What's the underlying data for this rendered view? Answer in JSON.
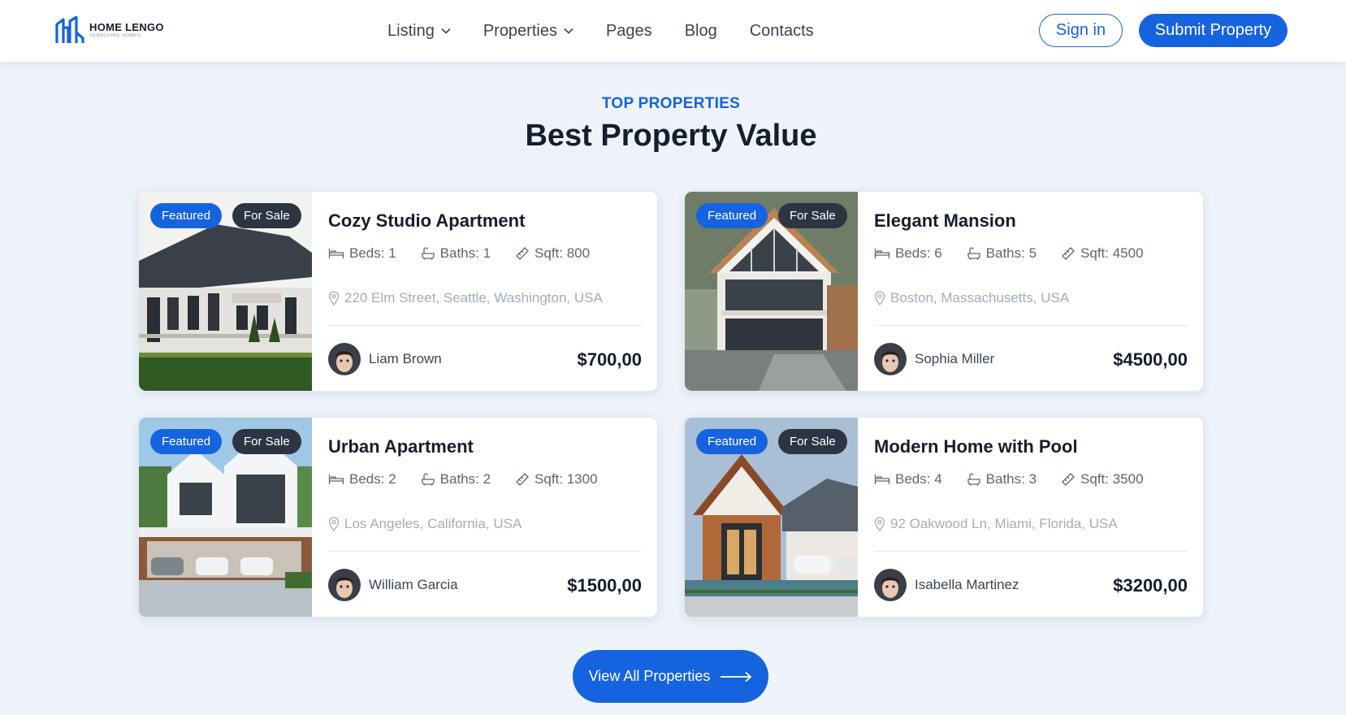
{
  "brand": {
    "name": "HOME LENGO",
    "tagline": "SEARCHING HOMES",
    "color": "#1563df"
  },
  "nav": {
    "items": [
      {
        "label": "Listing",
        "dropdown": true
      },
      {
        "label": "Properties",
        "dropdown": true
      },
      {
        "label": "Pages",
        "dropdown": false
      },
      {
        "label": "Blog",
        "dropdown": false
      },
      {
        "label": "Contacts",
        "dropdown": false
      }
    ],
    "signin_label": "Sign in",
    "submit_label": "Submit Property"
  },
  "section": {
    "eyebrow": "TOP PROPERTIES",
    "title": "Best Property Value"
  },
  "badges": {
    "featured": "Featured",
    "sale": "For Sale"
  },
  "properties": [
    {
      "title": "Cozy Studio Apartment",
      "beds": "Beds: 1",
      "baths": "Baths: 1",
      "sqft": "Sqft: 800",
      "address": "220 Elm Street, Seattle, Washington, USA",
      "agent": "Liam Brown",
      "price": "$700,00"
    },
    {
      "title": "Elegant Mansion",
      "beds": "Beds: 6",
      "baths": "Baths: 5",
      "sqft": "Sqft: 4500",
      "address": "Boston, Massachusetts, USA",
      "agent": "Sophia Miller",
      "price": "$4500,00"
    },
    {
      "title": "Urban Apartment",
      "beds": "Beds: 2",
      "baths": "Baths: 2",
      "sqft": "Sqft: 1300",
      "address": "Los Angeles, California, USA",
      "agent": "William Garcia",
      "price": "$1500,00"
    },
    {
      "title": "Modern Home with Pool",
      "beds": "Beds: 4",
      "baths": "Baths: 3",
      "sqft": "Sqft: 3500",
      "address": "92 Oakwood Ln, Miami, Florida, USA",
      "agent": "Isabella Martinez",
      "price": "$3200,00"
    }
  ],
  "cta": {
    "label": "View All Properties",
    "icon": "arrow-right-icon"
  },
  "icons": [
    "bed-icon",
    "bath-icon",
    "ruler-icon",
    "map-pin-icon",
    "chevron-down-icon"
  ]
}
